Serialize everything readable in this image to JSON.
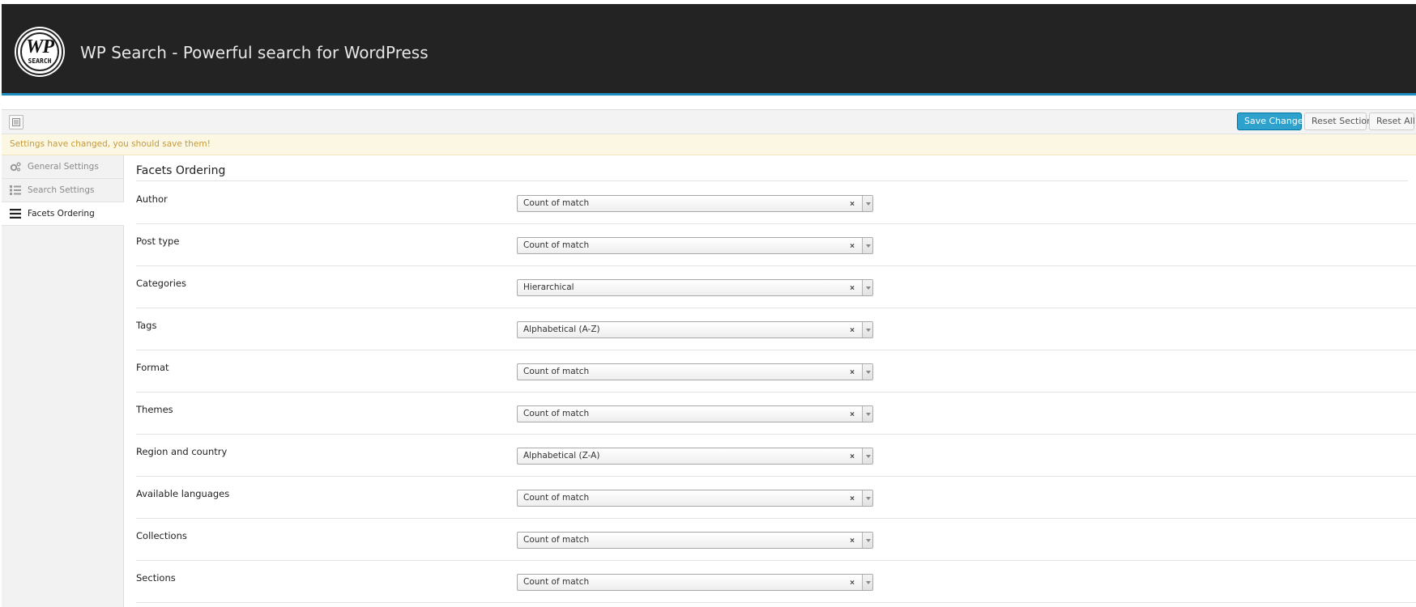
{
  "header": {
    "logo_text": "WP",
    "logo_subtext": "SEARCH",
    "title": "WP Search - Powerful search for WordPress"
  },
  "toolbar": {
    "save_label": "Save Changes",
    "reset_section_label": "Reset Section",
    "reset_all_label": "Reset All"
  },
  "notice": {
    "text": "Settings have changed, you should save them!"
  },
  "sidebar": {
    "items": [
      {
        "label": "General Settings",
        "icon": "cogs-icon",
        "active": false
      },
      {
        "label": "Search Settings",
        "icon": "list-icon",
        "active": false
      },
      {
        "label": "Facets Ordering",
        "icon": "menu-icon",
        "active": true
      }
    ]
  },
  "main": {
    "section_title": "Facets Ordering",
    "rows": [
      {
        "label": "Author",
        "value": "Count of match"
      },
      {
        "label": "Post type",
        "value": "Count of match"
      },
      {
        "label": "Categories",
        "value": "Hierarchical"
      },
      {
        "label": "Tags",
        "value": "Alphabetical (A-Z)"
      },
      {
        "label": "Format",
        "value": "Count of match"
      },
      {
        "label": "Themes",
        "value": "Count of match"
      },
      {
        "label": "Region and country",
        "value": "Alphabetical (Z-A)"
      },
      {
        "label": "Available languages",
        "value": "Count of match"
      },
      {
        "label": "Collections",
        "value": "Count of match"
      },
      {
        "label": "Sections",
        "value": "Count of match"
      }
    ]
  },
  "colors": {
    "header_bg": "#232323",
    "accent": "#2ea2cc",
    "notice_text": "#c59a3b",
    "notice_bg": "#fbf7e3"
  }
}
